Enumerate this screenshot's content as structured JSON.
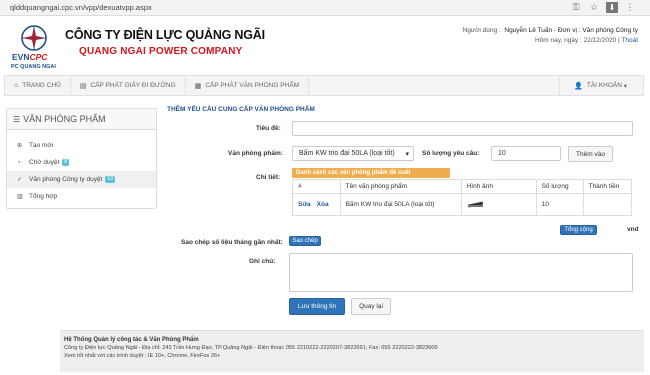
{
  "browser": {
    "url": "qlddquangngai.cpc.vn/vpp/dexuatvpp.aspx"
  },
  "header": {
    "logo_text": "EVNCPC",
    "logo_sub": "PC QUANG NGAI",
    "company_vn": "CÔNG TY ĐIỆN LỰC QUẢNG NGÃI",
    "company_en": "QUANG NGAI POWER COMPANY",
    "user_label": "Người dùng :",
    "user_value": "Nguyễn Lê Tuấn - Đơn vị : Văn phòng Công ty",
    "today_label": "Hôm nay, ngày :",
    "today_value": "22/12/2020",
    "logout": "Thoát"
  },
  "nav": {
    "items": [
      {
        "label": "TRANG CHỦ"
      },
      {
        "label": "CẤP PHÁT GIẤY ĐI ĐƯỜNG"
      },
      {
        "label": "CẤP PHÁT VĂN PHÒNG PHẨM"
      }
    ],
    "account": "TÀI KHOẢN"
  },
  "sidebar": {
    "title": "VĂN PHÒNG PHẨM",
    "items": [
      {
        "label": "Tạo mới"
      },
      {
        "label": "Chờ duyệt",
        "badge": "8"
      },
      {
        "label": "Văn phòng Công ty duyệt",
        "badge": "19"
      },
      {
        "label": "Tổng hợp"
      }
    ]
  },
  "form": {
    "title": "THÊM YÊU CẦU CUNG CẤP VĂN PHÒNG PHẨM",
    "tieude_label": "Tiêu đề:",
    "tieude_value": "",
    "vpp_label": "Văn phòng phẩm:",
    "vpp_selected": "Bấm KW trio đại 50LA (loại tốt)",
    "soluong_label": "Số lượng yêu cầu:",
    "soluong_value": "10",
    "add_button": "Thêm vào",
    "chitiet_label": "Chi tiết:",
    "list_tag": "Danh sách các văn phòng phẩm đề xuất",
    "table": {
      "headers": [
        "#",
        "Tên văn phòng phẩm",
        "Hình ảnh",
        "Số lượng",
        "Thành tiền"
      ],
      "rows": [
        {
          "edit": "Sửa",
          "delete": "Xóa",
          "name": "Bấm KW trio đại 50LA (loại tốt)",
          "qty": "10",
          "total": ""
        }
      ]
    },
    "total_button": "Tổng cộng",
    "currency": "vnd",
    "copy_label": "Sao chép số liệu tháng gần nhất:",
    "copy_button": "Sao chép",
    "note_label": "Ghi chú:",
    "save_button": "Lưu thông tin",
    "back_button": "Quay lại"
  },
  "footer": {
    "title": "Hệ Thống Quản lý công tác & Văn Phòng Phẩm",
    "line1": "Công ty Điện lực Quảng Ngãi - Địa chỉ: 243 Trần Hưng Đạo, TP.Quảng Ngãi - Điện thoại: 055 2210222-2220207-3822691; Fax: 055 2220222-3823600",
    "line2": "Xem tốt nhất với các trình duyệt : IE 10+, Chrome, FireFox 26+"
  },
  "colors": {
    "brand_red": "#d3151b",
    "link_blue": "#1f4f8a",
    "primary": "#2f73b8",
    "warning": "#f0ad4e",
    "info": "#5bc0de"
  }
}
